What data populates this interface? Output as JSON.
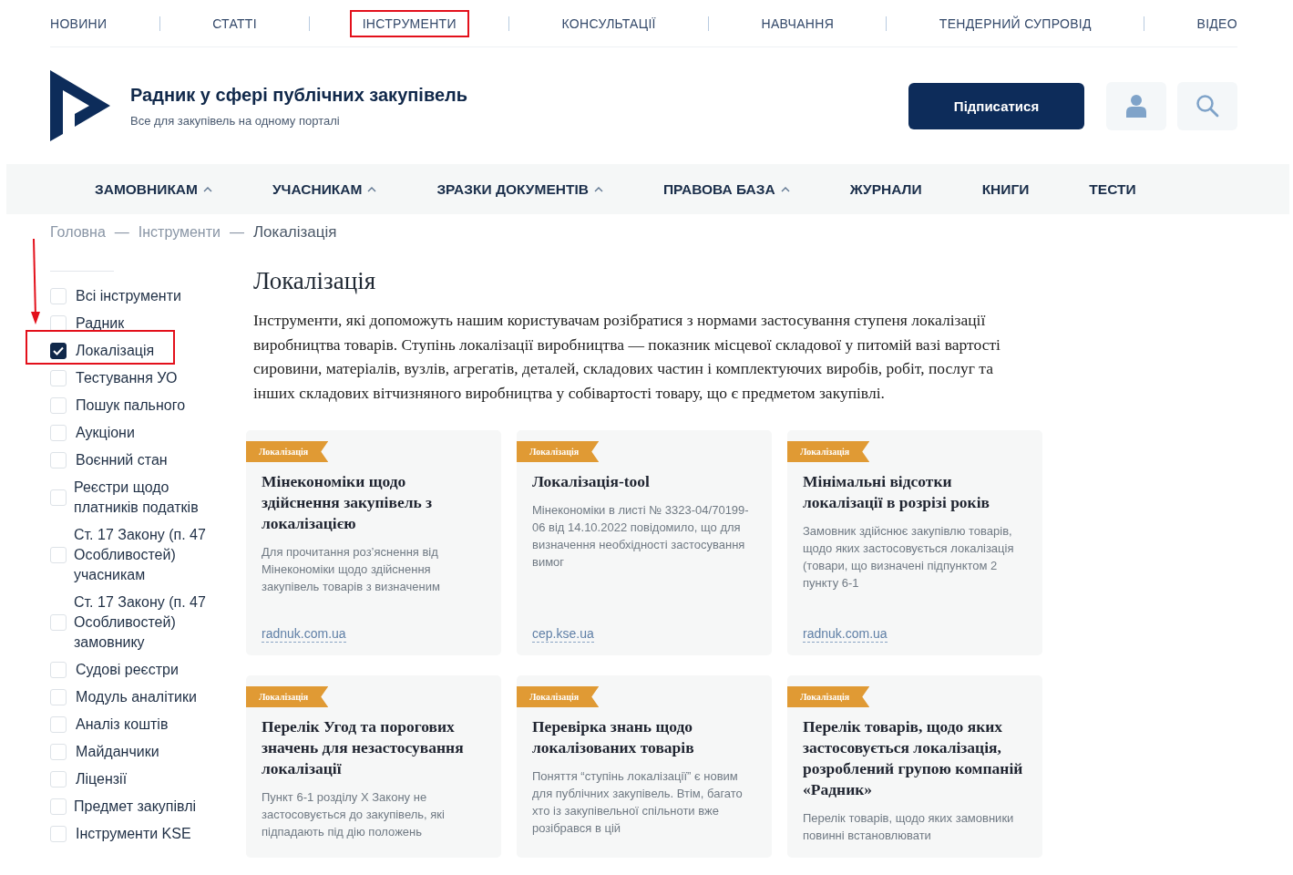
{
  "top_nav": [
    {
      "label": "НОВИНИ",
      "highlighted": false
    },
    {
      "label": "СТАТТІ",
      "highlighted": false
    },
    {
      "label": "ІНСТРУМЕНТИ",
      "highlighted": true
    },
    {
      "label": "КОНСУЛЬТАЦІЇ",
      "highlighted": false
    },
    {
      "label": "НАВЧАННЯ",
      "highlighted": false
    },
    {
      "label": "ТЕНДЕРНИЙ СУПРОВІД",
      "highlighted": false
    },
    {
      "label": "ВІДЕО",
      "highlighted": false
    }
  ],
  "header": {
    "title": "Радник у сфері публічних закупівель",
    "subtitle": "Все для закупівель на одному порталі",
    "subscribe_button": "Підписатися"
  },
  "main_menu": [
    {
      "label": "ЗАМОВНИКАМ",
      "has_dropdown": true
    },
    {
      "label": "УЧАСНИКАМ",
      "has_dropdown": true
    },
    {
      "label": "ЗРАЗКИ ДОКУМЕНТІВ",
      "has_dropdown": true
    },
    {
      "label": "ПРАВОВА БАЗА",
      "has_dropdown": true
    },
    {
      "label": "ЖУРНАЛИ",
      "has_dropdown": false
    },
    {
      "label": "КНИГИ",
      "has_dropdown": false
    },
    {
      "label": "ТЕСТИ",
      "has_dropdown": false
    }
  ],
  "breadcrumb": {
    "items": [
      "Головна",
      "Інструменти",
      "Локалізація"
    ],
    "separator": "—"
  },
  "filters": [
    {
      "label": "Всі інструменти",
      "checked": false,
      "highlighted": false
    },
    {
      "label": "Радник",
      "checked": false,
      "highlighted": false
    },
    {
      "label": "Локалізація",
      "checked": true,
      "highlighted": true
    },
    {
      "label": "Тестування УО",
      "checked": false,
      "highlighted": false
    },
    {
      "label": "Пошук пального",
      "checked": false,
      "highlighted": false
    },
    {
      "label": "Аукціони",
      "checked": false,
      "highlighted": false
    },
    {
      "label": "Воєнний стан",
      "checked": false,
      "highlighted": false
    },
    {
      "label": "Реєстри щодо платників податків",
      "checked": false,
      "highlighted": false
    },
    {
      "label": "Ст. 17 Закону (п. 47 Особливостей) учасникам",
      "checked": false,
      "highlighted": false
    },
    {
      "label": "Ст. 17 Закону (п. 47 Особливостей) замовнику",
      "checked": false,
      "highlighted": false
    },
    {
      "label": "Судові реєстри",
      "checked": false,
      "highlighted": false
    },
    {
      "label": "Модуль аналітики",
      "checked": false,
      "highlighted": false
    },
    {
      "label": "Аналіз коштів",
      "checked": false,
      "highlighted": false
    },
    {
      "label": "Майданчики",
      "checked": false,
      "highlighted": false
    },
    {
      "label": "Ліцензії",
      "checked": false,
      "highlighted": false
    },
    {
      "label": "Предмет закупівлі",
      "checked": false,
      "highlighted": false
    },
    {
      "label": "Інструменти KSE",
      "checked": false,
      "highlighted": false
    }
  ],
  "page": {
    "title": "Локалізація",
    "description": "Інструменти, які допоможуть нашим користувачам розібратися з нормами застосування ступеня локалізації виробництва товарів. Ступінь локалізації виробництва — показник місцевої складової у питомій вазі вартості сировини, матеріалів, вузлів, агрегатів, деталей, складових частин і комплектуючих виробів, робіт, послуг та інших складових вітчизняного виробництва у собівартості товару, що є предметом закупівлі."
  },
  "cards": [
    {
      "tag": "Локалізація",
      "title": "Мінекономіки щодо здійснення закупівель з локалізацією",
      "excerpt": "Для прочитання роз’яснення від Мінекономіки щодо здійснення закупівель товарів з визначеним",
      "source": "radnuk.com.ua"
    },
    {
      "tag": "Локалізація",
      "title": "Локалізація-tool",
      "excerpt": "Мінекономіки в листі № 3323-04/70199-06 від 14.10.2022 повідомило, що для визначення необхідності застосування вимог",
      "source": "cep.kse.ua"
    },
    {
      "tag": "Локалізація",
      "title": "Мінімальні відсотки локалізації в розрізі років",
      "excerpt": "Замовник здійснює закупівлю товарів, щодо яких застосовується локалізація (товари, що визначені підпунктом 2 пункту 6-1",
      "source": "radnuk.com.ua"
    },
    {
      "tag": "Локалізація",
      "title": "Перелік Угод та порогових значень для незастосування локалізації",
      "excerpt": "Пункт 6-1 розділу X Закону не застосовується до закупівель, які підпадають під дію положень"
    },
    {
      "tag": "Локалізація",
      "title": "Перевірка знань щодо локалізованих товарів",
      "excerpt": "Поняття “ступінь локалізації” є новим для публічних закупівель. Втім, багато хто із закупівельної спільноти вже розібрався в цій"
    },
    {
      "tag": "Локалізація",
      "title": "Перелік товарів, щодо яких застосовується локалізація, розроблений групою компаній «Радник»",
      "excerpt": "Перелік товарів, щодо яких замовники повинні встановлювати"
    }
  ]
}
